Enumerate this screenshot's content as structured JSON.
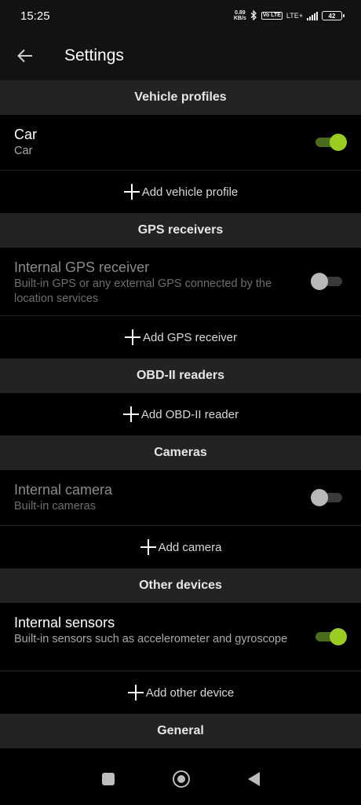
{
  "status_bar": {
    "time": "15:25",
    "net_speed_value": "0.89",
    "net_speed_unit": "KB/s",
    "volte": "Vo LTE",
    "lte": "LTE+",
    "battery": "42"
  },
  "app_bar": {
    "title": "Settings"
  },
  "sections": {
    "vehicle_profiles": {
      "title": "Vehicle profiles",
      "devices": [
        {
          "name": "Car",
          "description": "Car",
          "enabled": true
        }
      ],
      "add_label": "Add vehicle profile"
    },
    "gps_receivers": {
      "title": "GPS receivers",
      "devices": [
        {
          "name": "Internal GPS receiver",
          "description": "Built-in GPS or any external GPS connected by the location services",
          "enabled": false
        }
      ],
      "add_label": "Add GPS receiver"
    },
    "obd_readers": {
      "title": "OBD-II readers",
      "add_label": "Add OBD-II reader"
    },
    "cameras": {
      "title": "Cameras",
      "devices": [
        {
          "name": "Internal camera",
          "description": "Built-in cameras",
          "enabled": false
        }
      ],
      "add_label": "Add camera"
    },
    "other_devices": {
      "title": "Other devices",
      "devices": [
        {
          "name": "Internal sensors",
          "description": "Built-in sensors such as accelerometer and gyroscope",
          "enabled": true
        }
      ],
      "add_label": "Add other device"
    },
    "general": {
      "title": "General"
    }
  },
  "colors": {
    "accent": "#9acd22",
    "header_bg": "#232323",
    "app_bar_bg": "#121212"
  }
}
